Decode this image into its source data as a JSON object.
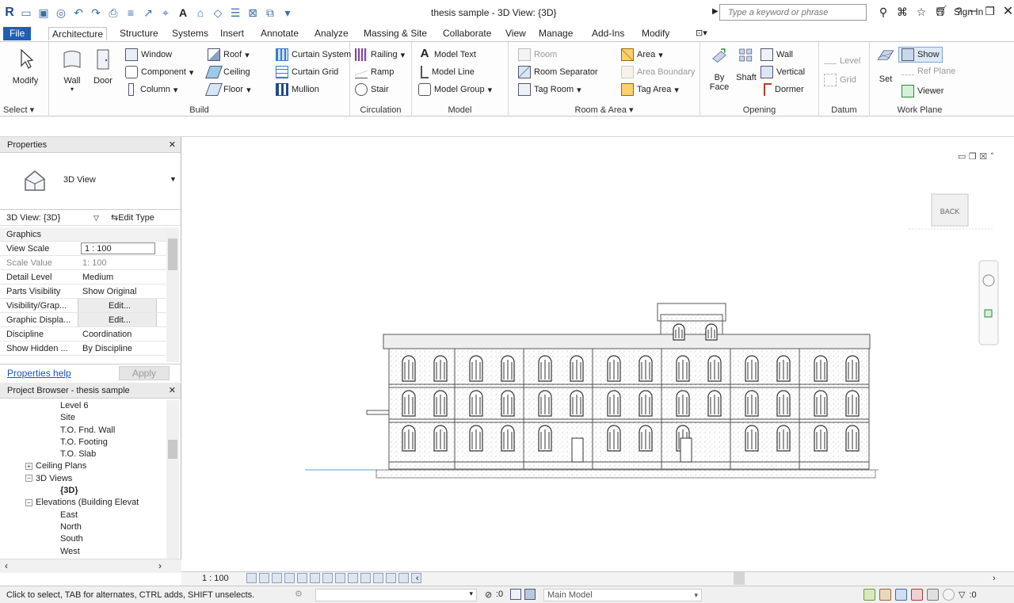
{
  "title_bar": {
    "document_title": "thesis sample - 3D View: {3D}",
    "search_placeholder": "Type a keyword or phrase",
    "sign_in": "Sign In"
  },
  "menu": {
    "tabs": [
      "File",
      "Architecture",
      "Structure",
      "Systems",
      "Insert",
      "Annotate",
      "Analyze",
      "Massing & Site",
      "Collaborate",
      "View",
      "Manage",
      "Add-Ins",
      "Modify"
    ],
    "active": "Architecture"
  },
  "ribbon": {
    "select": {
      "modify": "Modify",
      "label": "Select ▾"
    },
    "build": {
      "label": "Build",
      "wall": "Wall",
      "door": "Door",
      "window": "Window",
      "component": "Component",
      "column": "Column",
      "roof": "Roof",
      "ceiling": "Ceiling",
      "floor": "Floor",
      "curtain_system": "Curtain System",
      "curtain_grid": "Curtain Grid",
      "mullion": "Mullion"
    },
    "circulation": {
      "label": "Circulation",
      "railing": "Railing",
      "ramp": "Ramp",
      "stair": "Stair"
    },
    "model": {
      "label": "Model",
      "model_text": "Model Text",
      "model_line": "Model Line",
      "model_group": "Model Group"
    },
    "room_area": {
      "label": "Room & Area ▾",
      "room": "Room",
      "room_separator": "Room Separator",
      "tag_room": "Tag Room",
      "area": "Area",
      "area_boundary": "Area Boundary",
      "tag_area": "Tag Area"
    },
    "opening": {
      "label": "Opening",
      "by_face_1": "By",
      "by_face_2": "Face",
      "shaft": "Shaft",
      "wall": "Wall",
      "vertical": "Vertical",
      "dormer": "Dormer"
    },
    "datum": {
      "label": "Datum",
      "level": "Level",
      "grid": "Grid"
    },
    "work_plane": {
      "label": "Work Plane",
      "set": "Set",
      "show": "Show",
      "ref_plane": "Ref Plane",
      "viewer": "Viewer"
    }
  },
  "properties": {
    "header": "Properties",
    "type_name": "3D View",
    "view_selector": "3D View: {3D}",
    "edit_type": "Edit Type",
    "group": "Graphics",
    "rows": [
      {
        "key": "View Scale",
        "value": "1 : 100"
      },
      {
        "key": "Scale Value",
        "value": "1: 100"
      },
      {
        "key": "Detail Level",
        "value": "Medium"
      },
      {
        "key": "Parts Visibility",
        "value": "Show Original"
      },
      {
        "key": "Visibility/Grap...",
        "value": "Edit..."
      },
      {
        "key": "Graphic Displa...",
        "value": "Edit..."
      },
      {
        "key": "Discipline",
        "value": "Coordination"
      },
      {
        "key": "Show Hidden ...",
        "value": "By Discipline"
      }
    ],
    "help": "Properties help",
    "apply": "Apply"
  },
  "project_browser": {
    "header": "Project Browser - thesis sample",
    "nodes": [
      {
        "label": "Level 6",
        "indent": 3,
        "toggle": ""
      },
      {
        "label": "Site",
        "indent": 3,
        "toggle": ""
      },
      {
        "label": "T.O. Fnd. Wall",
        "indent": 3,
        "toggle": ""
      },
      {
        "label": "T.O. Footing",
        "indent": 3,
        "toggle": ""
      },
      {
        "label": "T.O. Slab",
        "indent": 3,
        "toggle": ""
      },
      {
        "label": "Ceiling Plans",
        "indent": 1,
        "toggle": "+"
      },
      {
        "label": "3D Views",
        "indent": 1,
        "toggle": "−"
      },
      {
        "label": "{3D}",
        "indent": 3,
        "toggle": "",
        "bold": true
      },
      {
        "label": "Elevations (Building Elevat",
        "indent": 1,
        "toggle": "−"
      },
      {
        "label": "East",
        "indent": 3,
        "toggle": ""
      },
      {
        "label": "North",
        "indent": 3,
        "toggle": ""
      },
      {
        "label": "South",
        "indent": 3,
        "toggle": ""
      },
      {
        "label": "West",
        "indent": 3,
        "toggle": ""
      }
    ]
  },
  "canvas": {
    "viewcube_face": "BACK",
    "scale": "1 : 100"
  },
  "status_bar": {
    "message": "Click to select, TAB for alternates, CTRL adds, SHIFT unselects.",
    "filter_count": ":0",
    "model": "Main Model",
    "selection_count": ":0"
  },
  "colors": {
    "file_tab": "#1f5fb4",
    "link": "#1a57b8",
    "ribbon_icon": "#3a6ea5"
  }
}
